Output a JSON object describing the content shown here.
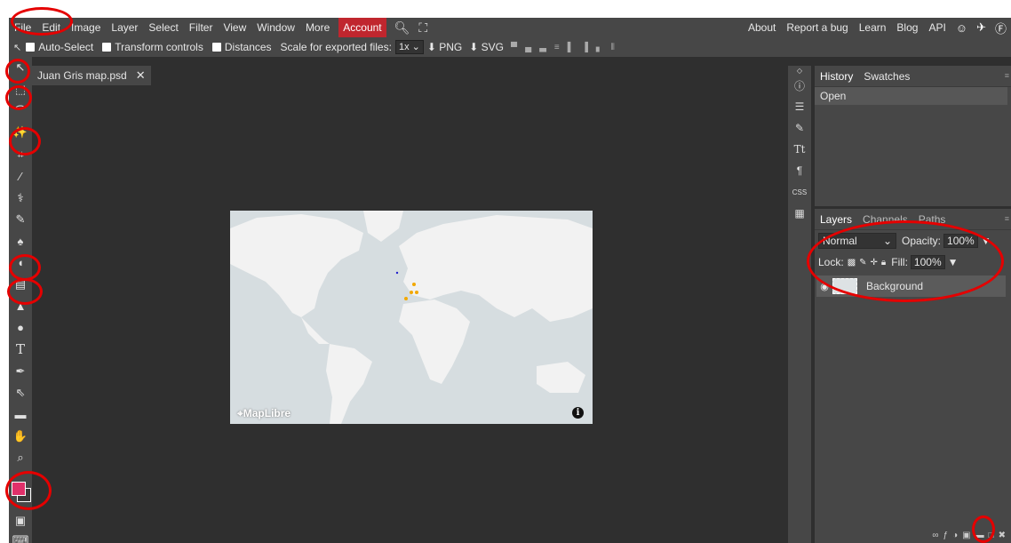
{
  "menu": {
    "items": [
      "File",
      "Edit",
      "Image",
      "Layer",
      "Select",
      "Filter",
      "View",
      "Window",
      "More"
    ],
    "account": "Account",
    "right_links": [
      "About",
      "Report a bug",
      "Learn",
      "Blog",
      "API"
    ]
  },
  "options": {
    "auto_select": "Auto-Select",
    "transform_controls": "Transform controls",
    "distances": "Distances",
    "scale_label": "Scale for exported files:",
    "scale_value": "1x",
    "export_png": "PNG",
    "export_svg": "SVG"
  },
  "document": {
    "tab_title": "Juan Gris map.psd",
    "close": "✕"
  },
  "map": {
    "attribution": "MapLibre",
    "info": "i"
  },
  "right_strip": {
    "css": "CSS"
  },
  "history_panel": {
    "tabs": [
      "History",
      "Swatches"
    ],
    "items": [
      "Open"
    ]
  },
  "layers_panel": {
    "tabs": [
      "Layers",
      "Channels",
      "Paths"
    ],
    "blend_mode": "Normal",
    "opacity_label": "Opacity:",
    "opacity_value": "100%",
    "lock_label": "Lock:",
    "fill_label": "Fill:",
    "fill_value": "100%",
    "layers": [
      {
        "name": "Background"
      }
    ]
  },
  "colors": {
    "foreground": "#e0306a",
    "accent_account": "#c0262e",
    "annotation": "#e50000"
  }
}
